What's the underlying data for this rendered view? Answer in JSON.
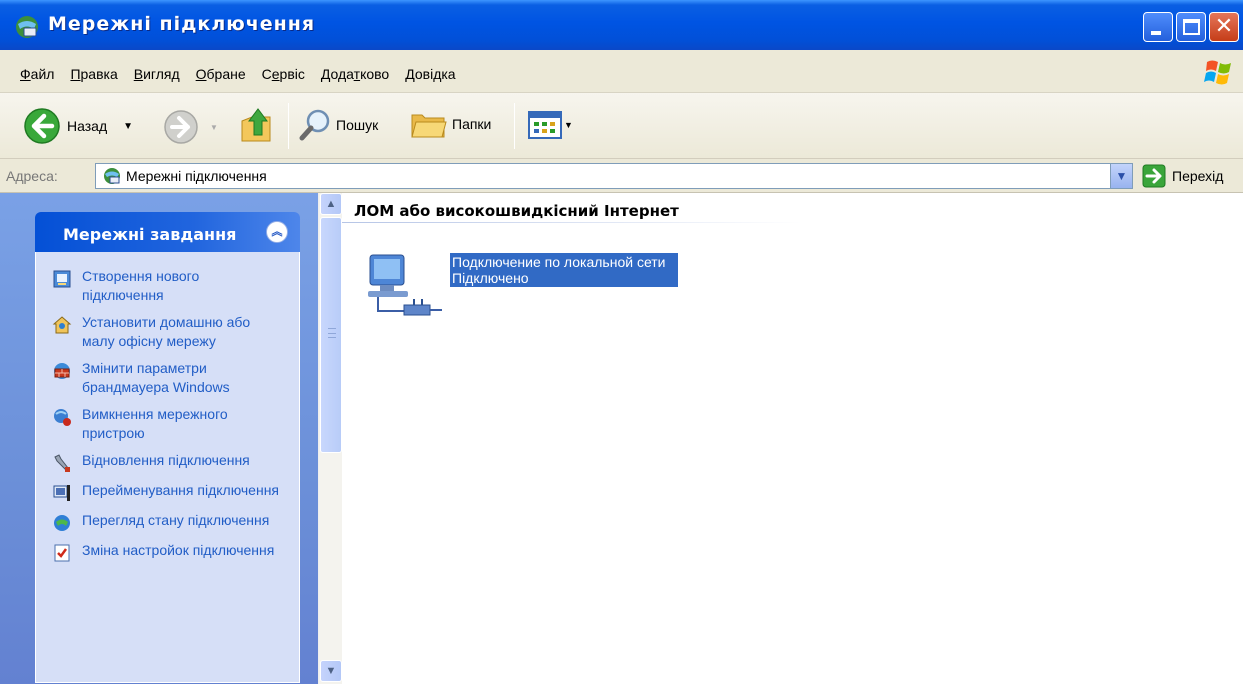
{
  "window": {
    "title": "Мережні підключення",
    "icon": "network-connections-icon"
  },
  "menu": {
    "items": [
      {
        "label": "Файл",
        "accel_index": 0
      },
      {
        "label": "Правка",
        "accel_index": 0
      },
      {
        "label": "Вигляд",
        "accel_index": 0
      },
      {
        "label": "Обране",
        "accel_index": 0
      },
      {
        "label": "Сервіс",
        "accel_index": 1
      },
      {
        "label": "Додатково",
        "accel_index": 4
      },
      {
        "label": "Довідка",
        "accel_index": 0
      }
    ]
  },
  "toolbar": {
    "back_label": "Назад",
    "search_label": "Пошук",
    "folders_label": "Папки"
  },
  "address": {
    "label": "Адреса:",
    "value": "Мережні підключення",
    "go_label": "Перехід"
  },
  "tasks": {
    "header": "Мережні завдання",
    "items": [
      {
        "label": "Створення нового підключення",
        "icon": "new-connection-icon"
      },
      {
        "label": "Установити домашню або малу офісну мережу",
        "icon": "home-network-icon"
      },
      {
        "label": "Змінити параметри брандмауера Windows",
        "icon": "firewall-icon"
      },
      {
        "label": "Вимкнення мережного пристрою",
        "icon": "disable-device-icon"
      },
      {
        "label": "Відновлення підключення",
        "icon": "repair-icon"
      },
      {
        "label": "Перейменування підключення",
        "icon": "rename-icon"
      },
      {
        "label": "Перегляд стану підключення",
        "icon": "status-icon"
      },
      {
        "label": "Зміна настройок підключення",
        "icon": "settings-icon"
      }
    ]
  },
  "content": {
    "group_title": "ЛОМ або високошвидкісний Інтернет",
    "connection": {
      "name": "Подключение по локальной сети",
      "status": "Підключено"
    }
  },
  "colors": {
    "titlebar": "#0054e3",
    "task_link": "#215dc6",
    "selection": "#316ac5"
  }
}
